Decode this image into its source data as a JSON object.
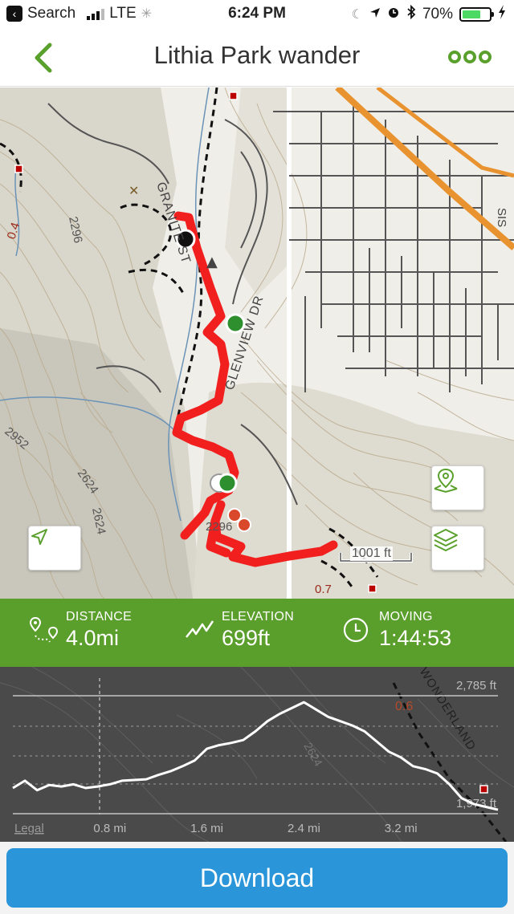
{
  "status_bar": {
    "back_app": "Search",
    "carrier": "LTE",
    "time": "6:24 PM",
    "battery": "70%",
    "battery_level": 0.7
  },
  "nav": {
    "title": "Lithia Park wander",
    "accent_color": "#5aa02c",
    "back_icon": "chevron-left-icon",
    "more_icon": "more-dots-icon"
  },
  "map": {
    "street_labels": [
      "GRANITE ST",
      "GLENVIEW DR",
      "SIS"
    ],
    "contour_labels": [
      "2296",
      "2952",
      "2624",
      "2624",
      "2296"
    ],
    "trail_labels": [
      "0.4",
      "0.7"
    ],
    "scale": "1001 ft",
    "track_color": "#f21f1f",
    "buttons": {
      "locate": "navigation-arrow-icon",
      "add_waypoint": "map-pin-icon",
      "layers": "layers-icon"
    }
  },
  "stats": {
    "background": "#5a9e2c",
    "distance": {
      "label": "DISTANCE",
      "value": "4.0mi",
      "icon": "route-pin-icon"
    },
    "elevation": {
      "label": "ELEVATION",
      "value": "699ft",
      "icon": "elevation-zigzag-icon"
    },
    "moving": {
      "label": "MOVING",
      "value": "1:44:53",
      "icon": "clock-icon"
    }
  },
  "profile": {
    "max_label": "2,785 ft",
    "min_label": "1,973 ft",
    "x_ticks": [
      "0.8 mi",
      "1.6 mi",
      "2.4 mi",
      "3.2 mi"
    ],
    "legal": "Legal",
    "map_labels": [
      "0.6",
      "WONDERLAND",
      "2624"
    ]
  },
  "chart_data": {
    "type": "line",
    "title": "",
    "xlabel": "",
    "ylabel": "",
    "ylim": [
      1973,
      2785
    ],
    "x_ticks": [
      0.8,
      1.6,
      2.4,
      3.2
    ],
    "series": [
      {
        "x": [
          0.0,
          0.1,
          0.2,
          0.3,
          0.4,
          0.5,
          0.6,
          0.7,
          0.8,
          0.9,
          1.0,
          1.1,
          1.2,
          1.3,
          1.4,
          1.5,
          1.6,
          1.7,
          1.8,
          1.9,
          2.0,
          2.1,
          2.2,
          2.3,
          2.4,
          2.5,
          2.6,
          2.7,
          2.8,
          2.9,
          3.0,
          3.1,
          3.2,
          3.3,
          3.4,
          3.5,
          3.6,
          3.7,
          3.8,
          3.9,
          4.0
        ],
        "values": [
          2150,
          2200,
          2135,
          2170,
          2160,
          2175,
          2150,
          2160,
          2175,
          2200,
          2205,
          2210,
          2240,
          2265,
          2300,
          2340,
          2420,
          2445,
          2460,
          2480,
          2540,
          2610,
          2660,
          2700,
          2740,
          2690,
          2640,
          2610,
          2580,
          2540,
          2470,
          2400,
          2360,
          2300,
          2280,
          2250,
          2175,
          2080,
          2040,
          2020,
          2000
        ]
      }
    ]
  },
  "download": {
    "label": "Download"
  }
}
